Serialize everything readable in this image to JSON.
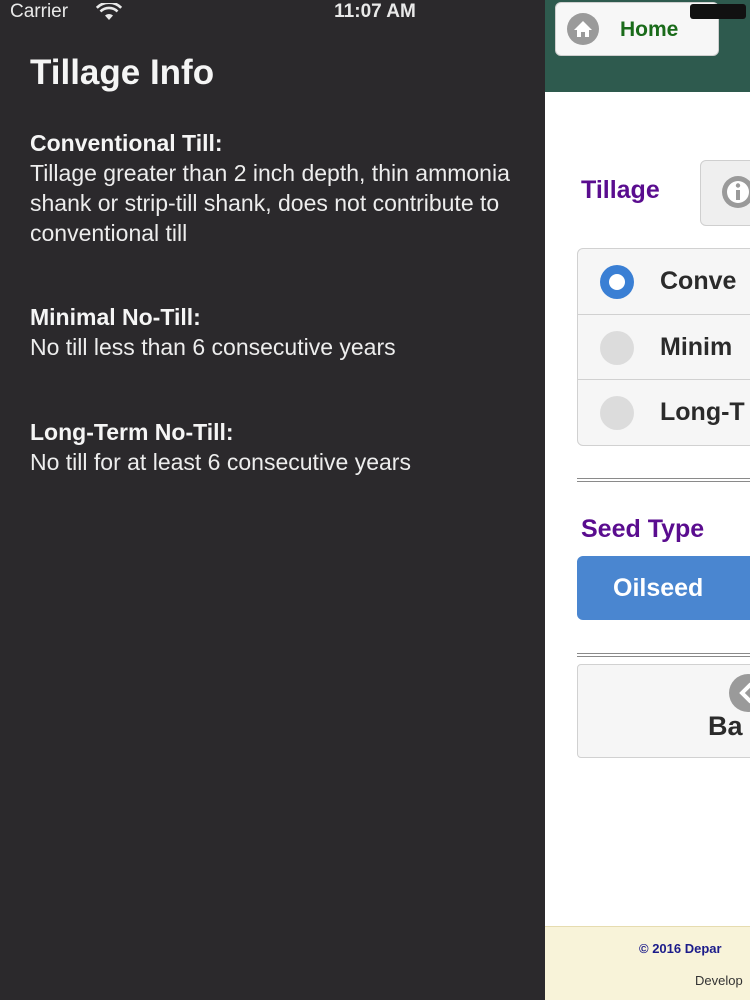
{
  "status_bar": {
    "carrier": "Carrier",
    "time": "11:07 AM",
    "wifi_icon": "wifi-icon",
    "battery_icon": "battery-icon"
  },
  "panel": {
    "title": "Tillage Info",
    "sections": [
      {
        "heading": "Conventional Till:",
        "text": "Tillage greater than 2 inch depth, thin ammonia shank or strip-till shank, does not contribute to conventional till"
      },
      {
        "heading": "Minimal No-Till:",
        "text": "No till less than 6 consecutive years"
      },
      {
        "heading": "Long-Term No-Till:",
        "text": "No till for at least 6 consecutive years"
      }
    ]
  },
  "app": {
    "header_color": "#2e5a4e",
    "home_button": {
      "label": "Home",
      "icon": "home-icon"
    },
    "tillage": {
      "label": "Tillage",
      "info_icon": "info-icon",
      "options": [
        {
          "label": "Conve",
          "selected": true
        },
        {
          "label": "Minim",
          "selected": false
        },
        {
          "label": "Long-T",
          "selected": false
        }
      ]
    },
    "seed_type": {
      "label": "Seed Type",
      "selected_button": "Oilseed"
    },
    "back_button": {
      "label": "Ba",
      "icon": "back-icon"
    },
    "footer": {
      "copyright": "© 2016 Depar",
      "developed": "Develop"
    }
  },
  "colors": {
    "panel_bg": "#2b292c",
    "accent_purple": "#5a0d8f",
    "button_blue": "#4a86d0",
    "home_green": "#1a6b1a"
  }
}
